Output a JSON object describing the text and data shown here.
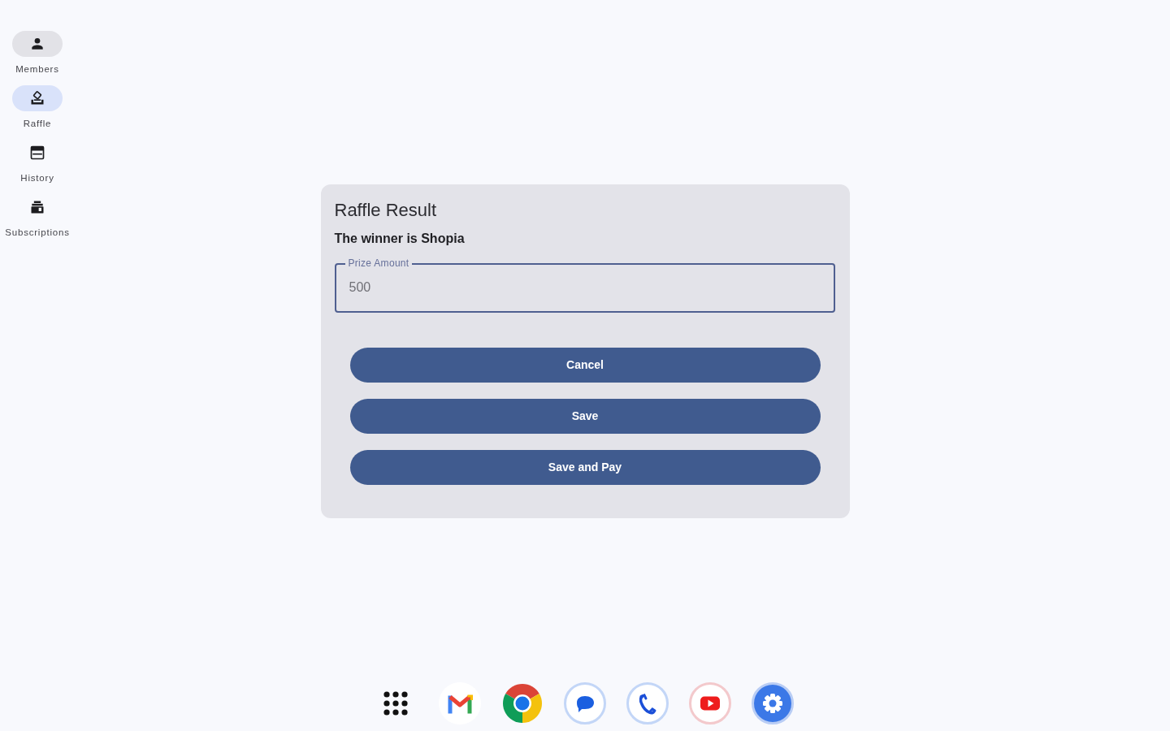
{
  "navigation_rail": {
    "items": [
      {
        "label": "Members",
        "selected": false,
        "hovered": true
      },
      {
        "label": "Raffle",
        "selected": true,
        "hovered": false
      },
      {
        "label": "History",
        "selected": false,
        "hovered": false
      },
      {
        "label": "Subscriptions",
        "selected": false,
        "hovered": false
      }
    ]
  },
  "dialog": {
    "title": "Raffle Result",
    "message": "The winner is Shopia",
    "field": {
      "label": "Prize Amount",
      "value": "500"
    },
    "buttons": [
      "Cancel",
      "Save",
      "Save and Pay"
    ]
  }
}
